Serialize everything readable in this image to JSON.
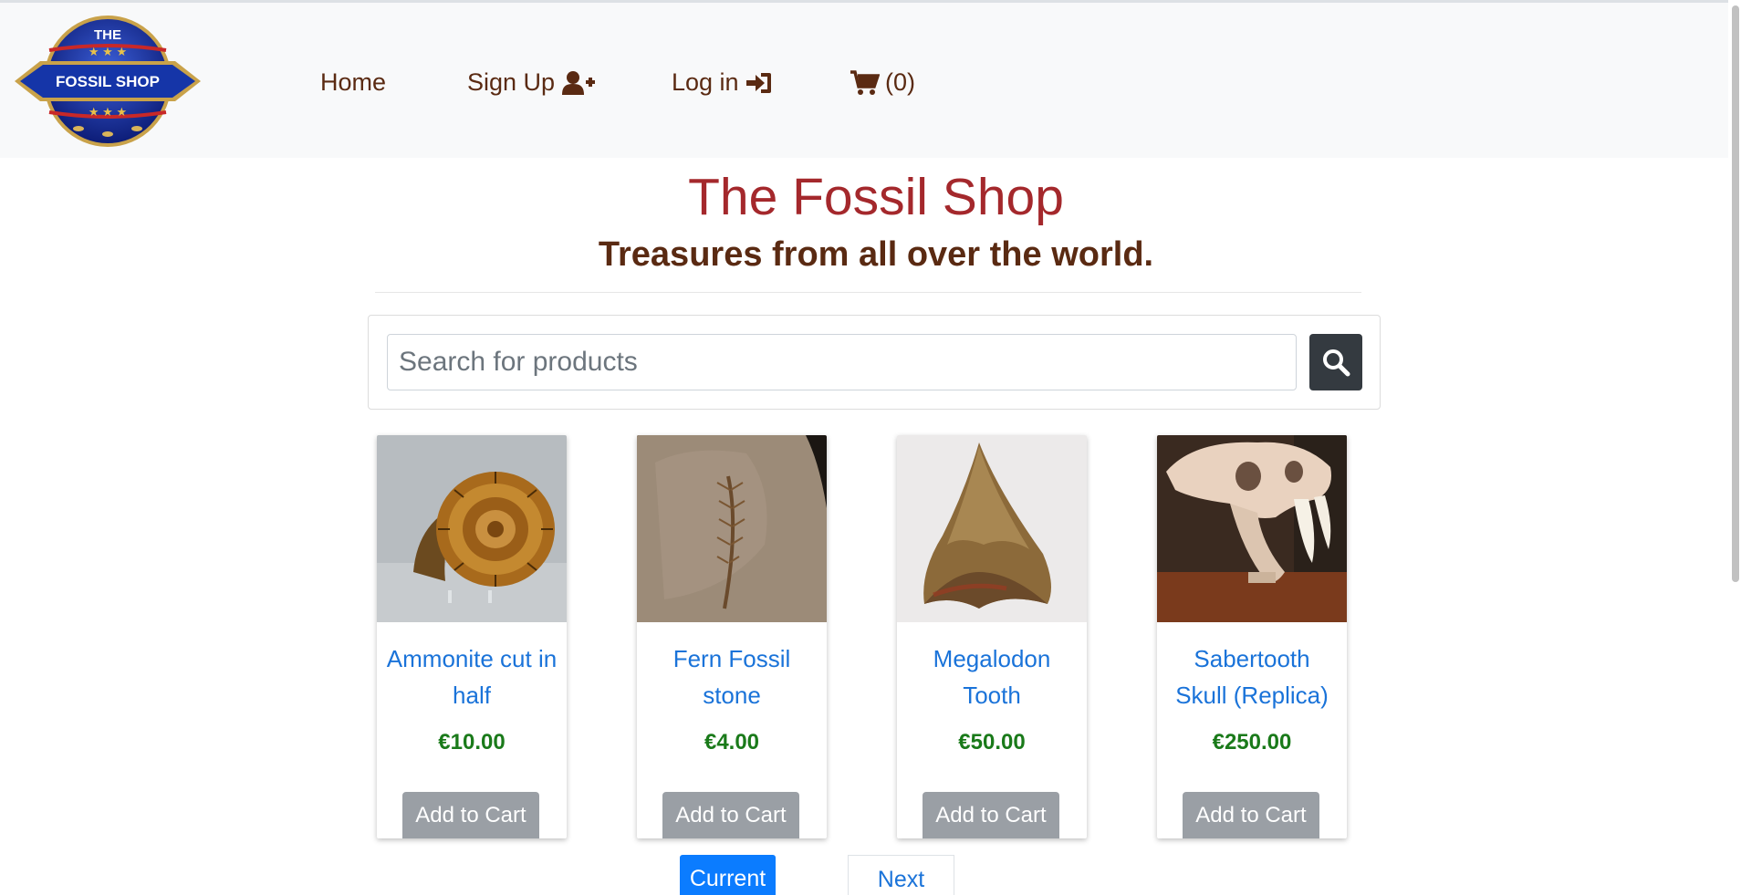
{
  "brand": {
    "logo_top_text": "THE",
    "logo_main_text": "FOSSIL SHOP",
    "colors": {
      "nav_text": "#5a2a12",
      "title": "#a4282c",
      "link": "#1a73d9",
      "price": "#1a7a1a"
    }
  },
  "nav": {
    "home_label": "Home",
    "signup_label": "Sign Up",
    "signup_icon": "user-plus-icon",
    "login_label": "Log in",
    "login_icon": "sign-in-icon",
    "cart_icon": "shopping-cart-icon",
    "cart_count": "(0)"
  },
  "header": {
    "title": "The Fossil Shop",
    "tagline": "Treasures from all over the world."
  },
  "search": {
    "placeholder": "Search for products",
    "value": "",
    "button_icon": "search-icon"
  },
  "products": [
    {
      "name": "Ammonite cut in half",
      "price": "€10.00",
      "button": "Add to Cart",
      "image": "ammonite-image"
    },
    {
      "name": "Fern Fossil stone",
      "price": "€4.00",
      "button": "Add to Cart",
      "image": "fern-fossil-image"
    },
    {
      "name": "Megalodon Tooth",
      "price": "€50.00",
      "button": "Add to Cart",
      "image": "megalodon-tooth-image"
    },
    {
      "name": "Sabertooth Skull (Replica)",
      "price": "€250.00",
      "button": "Add to Cart",
      "image": "sabertooth-skull-image"
    }
  ],
  "pagination": {
    "current_label": "Current",
    "next_label": "Next"
  }
}
